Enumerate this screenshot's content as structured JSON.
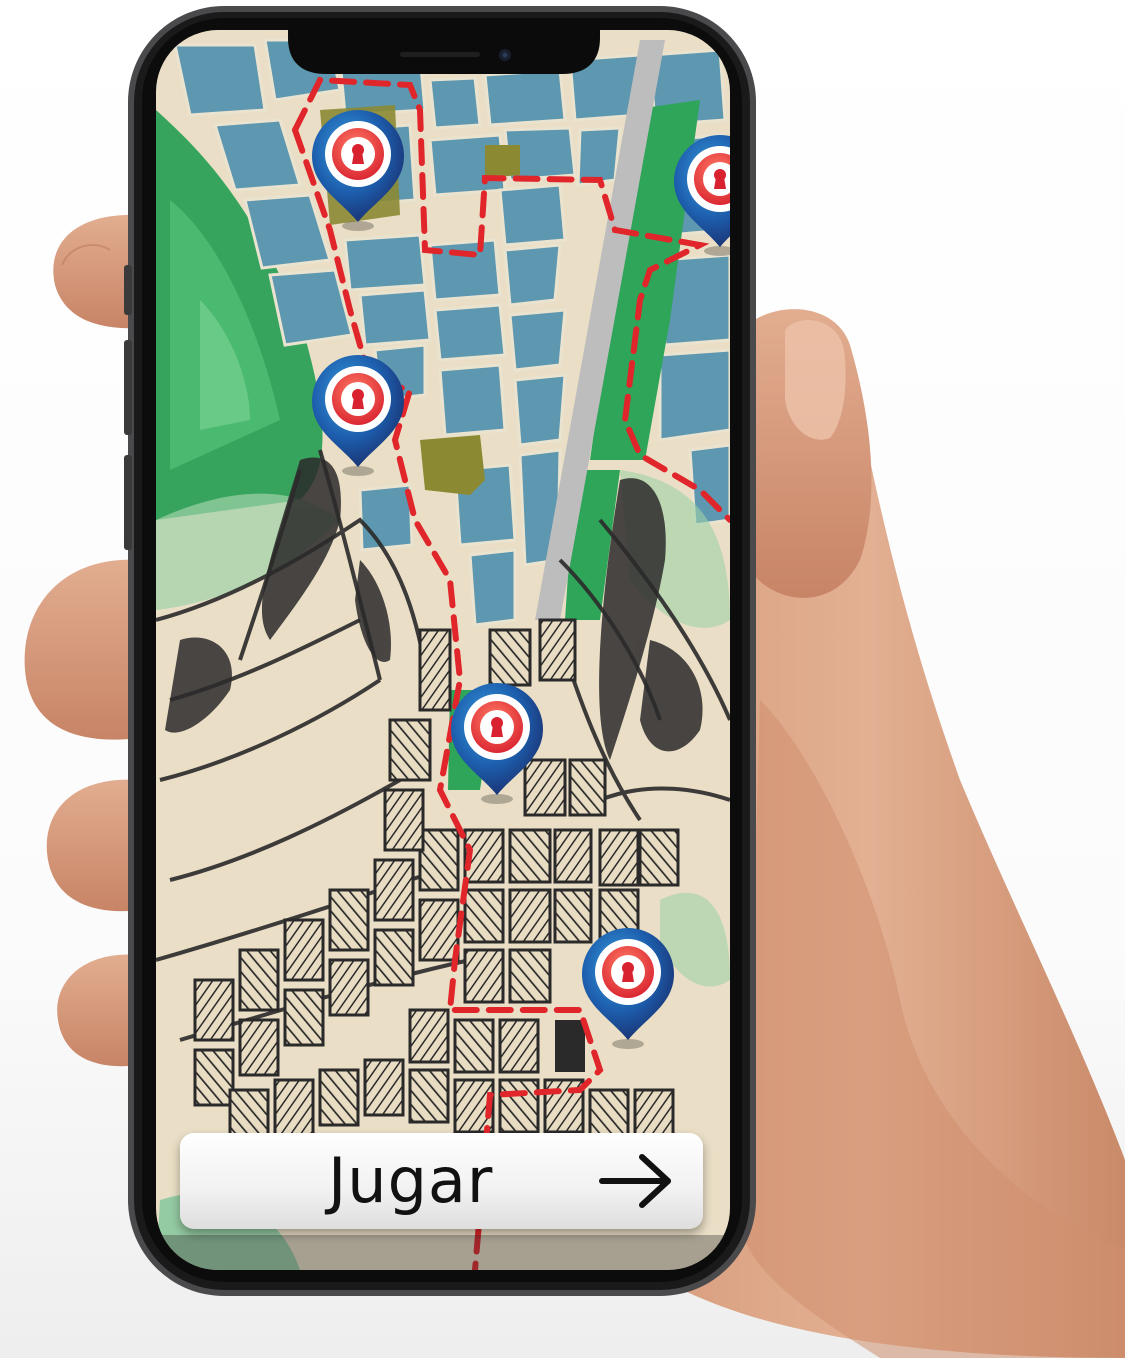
{
  "screen": {
    "map": {
      "icon": "treasure-map",
      "route_color": "#e0262b",
      "markers": [
        {
          "icon": "keyhole-location-pin"
        },
        {
          "icon": "keyhole-location-pin"
        },
        {
          "icon": "keyhole-location-pin"
        },
        {
          "icon": "keyhole-location-pin"
        },
        {
          "icon": "keyhole-location-pin"
        }
      ]
    },
    "play_button": {
      "label": "Jugar",
      "icon": "arrow-right"
    }
  },
  "colors": {
    "pin_outer": "#1f3f8c",
    "pin_ring": "#e8343b",
    "block_blue": "#5d97b0",
    "park_green": "#2fa55a",
    "paper": "#eadfc6"
  }
}
